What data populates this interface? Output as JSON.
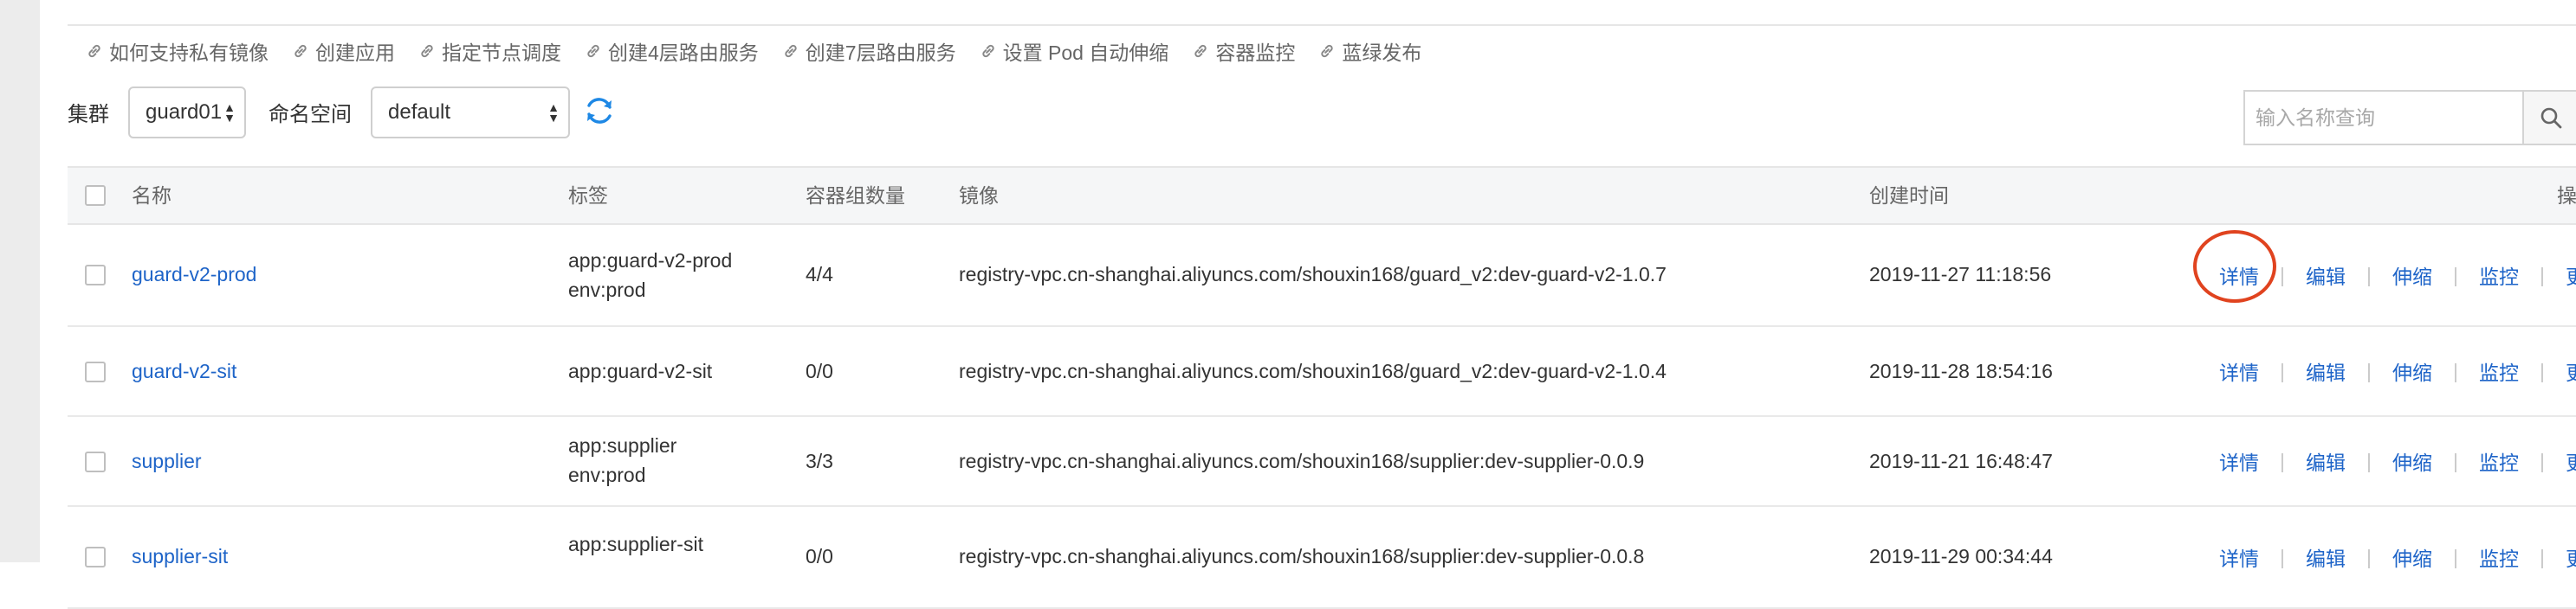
{
  "quick_links": [
    "如何支持私有镜像",
    "创建应用",
    "指定节点调度",
    "创建4层路由服务",
    "创建7层路由服务",
    "设置 Pod 自动伸缩",
    "容器监控",
    "蓝绿发布"
  ],
  "filters": {
    "cluster_label": "集群",
    "cluster_value": "guard01",
    "namespace_label": "命名空间",
    "namespace_value": "default",
    "search_placeholder": "输入名称查询"
  },
  "table": {
    "headers": {
      "name": "名称",
      "tags": "标签",
      "pods": "容器组数量",
      "image": "镜像",
      "created": "创建时间",
      "ops": "操作"
    },
    "rows": [
      {
        "name": "guard-v2-prod",
        "tags": [
          "app:guard-v2-prod",
          "env:prod"
        ],
        "pods": "4/4",
        "image": "registry-vpc.cn-shanghai.aliyuncs.com/shouxin168/guard_v2:dev-guard-v2-1.0.7",
        "created": "2019-11-27 11:18:56"
      },
      {
        "name": "guard-v2-sit",
        "tags": [
          "app:guard-v2-sit"
        ],
        "pods": "0/0",
        "image": "registry-vpc.cn-shanghai.aliyuncs.com/shouxin168/guard_v2:dev-guard-v2-1.0.4",
        "created": "2019-11-28 18:54:16"
      },
      {
        "name": "supplier",
        "tags": [
          "app:supplier",
          "env:prod"
        ],
        "pods": "3/3",
        "image": "registry-vpc.cn-shanghai.aliyuncs.com/shouxin168/supplier:dev-supplier-0.0.9",
        "created": "2019-11-21 16:48:47"
      },
      {
        "name": "supplier-sit",
        "tags": [
          "app:supplier-sit"
        ],
        "pods": "0/0",
        "image": "registry-vpc.cn-shanghai.aliyuncs.com/shouxin168/supplier:dev-supplier-0.0.8",
        "created": "2019-11-29 00:34:44"
      }
    ],
    "actions": [
      "详情",
      "编辑",
      "伸缩",
      "监控",
      "更多"
    ]
  },
  "colors": {
    "link": "#1e64c8",
    "highlight_circle": "#e0431f",
    "refresh_icon": "#1e88e5"
  },
  "icons": {
    "quick_link": "link-icon",
    "refresh": "refresh-icon",
    "search": "search-icon",
    "select_arrow": "updown-arrow-icon"
  }
}
